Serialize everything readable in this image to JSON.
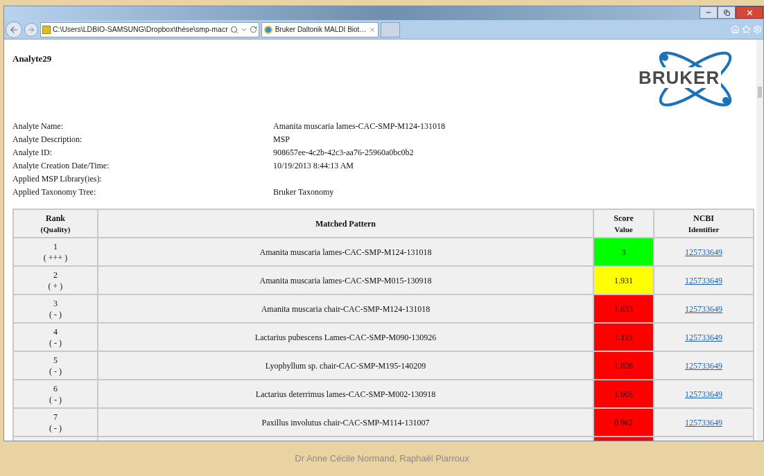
{
  "browser": {
    "address": "C:\\Users\\LDBIO-SAMSUNG\\Dropbox\\thèse\\smp-macr",
    "tab": {
      "label": "Bruker Daltonik MALDI Biot…",
      "selected": true
    }
  },
  "report": {
    "title": "Analyte29",
    "logo": "BRUKER",
    "fields": [
      {
        "label": "Analyte Name:",
        "value": "Amanita muscaria lames-CAC-SMP-M124-131018"
      },
      {
        "label": "Analyte Description:",
        "value": "MSP"
      },
      {
        "label": "Analyte ID:",
        "value": "908657ee-4c2b-42c3-aa76-25960a0bc0b2"
      },
      {
        "label": "Analyte Creation Date/Time:",
        "value": "10/19/2013 8:44:13 AM"
      },
      {
        "label": "Applied MSP Library(ies):"
      },
      {
        "label": "Applied Taxonomy Tree:",
        "value": "Bruker Taxonomy"
      }
    ],
    "table": {
      "columns": [
        [
          "Rank",
          "(Quality)"
        ],
        [
          "Matched Pattern"
        ],
        [
          "Score",
          "Value"
        ],
        [
          "NCBI",
          "Identifier"
        ]
      ],
      "rows": [
        {
          "rank": "1",
          "quality": "( +++ )",
          "pattern": "Amanita muscaria lames-CAC-SMP-M124-131018",
          "score": "3",
          "color": "#00ff00",
          "ncbi": "125733649"
        },
        {
          "rank": "2",
          "quality": "( + )",
          "pattern": "Amanita muscaria lames-CAC-SMP-M015-130918",
          "score": "1.931",
          "color": "#ffff00",
          "ncbi": "125733649"
        },
        {
          "rank": "3",
          "quality": "( - )",
          "pattern": "Amanita muscaria chair-CAC-SMP-M124-131018",
          "score": "1.633",
          "color": "#ff0000",
          "ncbi": "125733649"
        },
        {
          "rank": "4",
          "quality": "( - )",
          "pattern": "Lactarius pubescens Lames-CAC-SMP-M090-130926",
          "score": "1.115",
          "color": "#ff0000",
          "ncbi": "125733649"
        },
        {
          "rank": "5",
          "quality": "( - )",
          "pattern": "Lyophyllum sp. chair-CAC-SMP-M195-140209",
          "score": "1.028",
          "color": "#ff0000",
          "ncbi": "125733649"
        },
        {
          "rank": "6",
          "quality": "( - )",
          "pattern": "Lactarius deterrimus lames-CAC-SMP-M002-130918",
          "score": "1.005",
          "color": "#ff0000",
          "ncbi": "125733649"
        },
        {
          "rank": "7",
          "quality": "( - )",
          "pattern": "Paxillus involutus chair-CAC-SMP-M114-131007",
          "score": "0.962",
          "color": "#ff0000",
          "ncbi": "125733649"
        },
        {
          "color": "#ff0000"
        }
      ]
    }
  },
  "footer": "Dr Anne Cécile Normand, Raphaël Piarroux"
}
